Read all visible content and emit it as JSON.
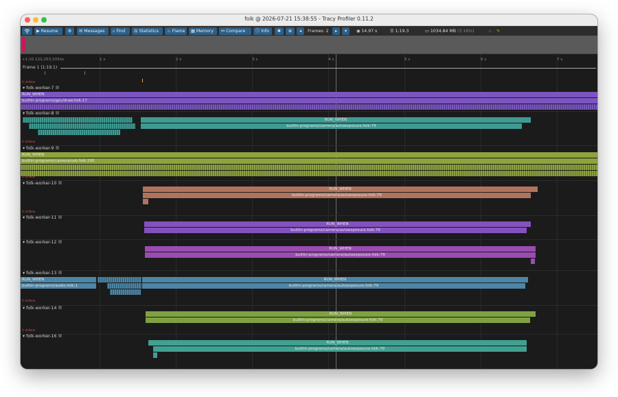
{
  "window": {
    "title": "folk @ 2026-07-21 15:38:55 - Tracy Profiler 0.11.2",
    "traffic": {
      "close": "#ff5f57",
      "minimize": "#febc2e",
      "zoom": "#28c840"
    }
  },
  "toolbar": {
    "wifi_icon": "wifi-icon",
    "resume": "Resume",
    "settings_icon": "gear-icon",
    "messages": "Messages",
    "find": "Find",
    "statistics": "Statistics",
    "flame": "Flame",
    "memory": "Memory",
    "compare": "Compare",
    "info": "Info",
    "tools_icon": "tools-icon",
    "zoom_icon": "zoom-icon",
    "frames_label": "Frames: 2",
    "view_time": "14.97 s",
    "trace_time": "1:19.3",
    "memory_usage": "1034.84 MB",
    "memory_pct": "(3.16%)",
    "colors": {
      "button": "#2e5f86",
      "memory_pct": "#888888",
      "alert": "#d9493d",
      "pen": "#e0a020"
    }
  },
  "timeline": {
    "start_label": "+1:10 122,253,333ns",
    "ticks": [
      "1 s",
      "2 s",
      "3 s",
      "4 s",
      "5 s",
      "6 s",
      "7 s"
    ],
    "frame_label": "Frame 1 (1:19.1)",
    "ctx_label": "0 dsNew"
  },
  "workers": [
    {
      "name": "folk-worker-7",
      "zones": [
        "RUN_WHEN",
        "builtin-programs/gpu/draw.folk:17"
      ]
    },
    {
      "name": "folk-worker-8",
      "zones": [
        "RUN_WHEN",
        "builtin-programs/camera/autoexposure.folk:79"
      ]
    },
    {
      "name": "folk-worker-9",
      "zones": [
        "RUN_WHEN",
        "builtin-programs/camera/usb.folk:295"
      ]
    },
    {
      "name": "folk-worker-10",
      "zones": [
        "RUN_WHEN",
        "builtin-programs/camera/autoexposure.folk:79"
      ]
    },
    {
      "name": "folk-worker-11",
      "zones": [
        "RUN_WHEN",
        "builtin-programs/camera/autoexposure.folk:79"
      ]
    },
    {
      "name": "folk-worker-12",
      "zones": [
        "RUN_WHEN",
        "builtin-programs/camera/autoexposure.folk:79"
      ]
    },
    {
      "name": "folk-worker-13",
      "zones": [
        "RUN_WHEN",
        "builtin-programs/audio.folk:1",
        "RUN_WHEN",
        "builtin-programs/camera/autoexposure.folk:79"
      ]
    },
    {
      "name": "folk-worker-14",
      "zones": [
        "RUN_WHEN",
        "builtin-programs/camera/autoexposure.folk:79"
      ]
    },
    {
      "name": "folk-worker-16",
      "zones": [
        "RUN_WHEN",
        "builtin-programs/camera/autoexposure.folk:79"
      ]
    }
  ],
  "zone_colors": {
    "draw": "#7b55c0",
    "autoexposure8": "#3d9b93",
    "usb": "#8da33e",
    "autoexposure10": "#b0735d",
    "autoexposure11": "#8352bd",
    "autoexposure12": "#9a4cb0",
    "audio": "#4c86a6",
    "autoexposure14": "#7fa241",
    "autoexposure16": "#41a091"
  }
}
